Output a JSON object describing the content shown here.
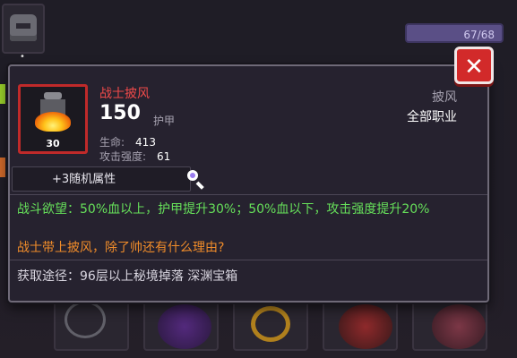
{
  "inventory": {
    "capacity": "67/68"
  },
  "tooltip": {
    "item_name": "战士披风",
    "level": "30",
    "armor_value": "150",
    "armor_label": "护甲",
    "stats": [
      {
        "label": "生命:",
        "value": "413"
      },
      {
        "label": "攻击强度:",
        "value": "61"
      }
    ],
    "item_type": "披风",
    "item_class": "全部职业",
    "random_attr": "+3随机属性",
    "effect": "战斗欲望：50%血以上，护甲提升30%；50%血以下，攻击强度提升20%",
    "flavor": "战士带上披风，除了帅还有什么理由?",
    "source": "获取途径：96层以上秘境掉落 深渊宝箱",
    "close_symbol": "✕"
  },
  "colors": {
    "name_red": "#f04a4a",
    "effect_green": "#66e05a",
    "flavor_orange": "#f08c2a",
    "close_red": "#d22a2a"
  }
}
